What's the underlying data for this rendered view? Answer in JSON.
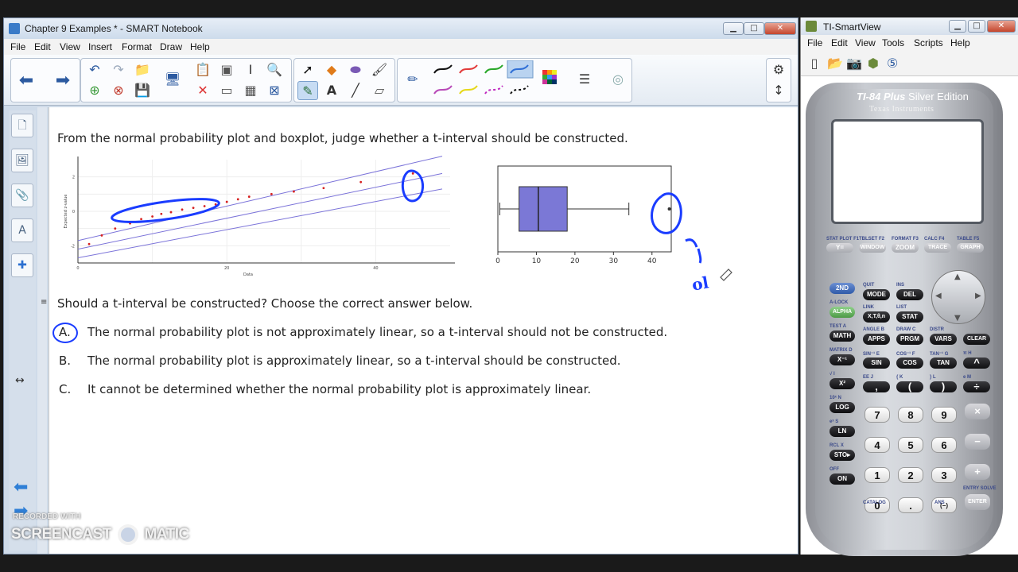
{
  "notebook": {
    "window_title": "Chapter 9 Examples * - SMART Notebook",
    "menu": [
      "File",
      "Edit",
      "View",
      "Insert",
      "Format",
      "Draw",
      "Help"
    ],
    "page": {
      "prompt": "From the normal probability plot and boxplot, judge whether a t-interval should be constructed.",
      "question": "Should a t-interval be constructed? Choose the correct answer below.",
      "options": [
        {
          "letter": "A.",
          "text": "The normal probability plot is not approximately linear, so a t-interval should not be constructed.",
          "circled": true
        },
        {
          "letter": "B.",
          "text": "The normal probability plot is approximately linear, so a t-interval should be constructed.",
          "circled": false
        },
        {
          "letter": "C.",
          "text": "It cannot be determined whether the normal probability plot is approximately linear.",
          "circled": false
        }
      ],
      "handwriting": "ol"
    },
    "pen_colors": [
      "#000000",
      "#e23b3b",
      "#2aa82a",
      "#2f6fd6",
      "#b84ab8",
      "#e6d81a",
      "#c02ac0",
      "#000000"
    ]
  },
  "chart_data": [
    {
      "type": "scatter",
      "title": "",
      "xlabel": "Data",
      "ylabel": "Expected z-value",
      "xlim": [
        0,
        50
      ],
      "ylim": [
        -3,
        3
      ],
      "xticks": [
        "0",
        "20",
        "40"
      ],
      "yticks": [
        "-2",
        "0",
        "2"
      ],
      "series": [
        {
          "values": [
            [
              1.5,
              -1.9
            ],
            [
              3.2,
              -1.4
            ],
            [
              5,
              -1.0
            ],
            [
              7,
              -0.7
            ],
            [
              8.5,
              -0.45
            ],
            [
              10,
              -0.3
            ],
            [
              11.2,
              -0.15
            ],
            [
              12.5,
              -0.05
            ],
            [
              14,
              0.1
            ],
            [
              15.5,
              0.2
            ],
            [
              17,
              0.3
            ],
            [
              18.5,
              0.4
            ],
            [
              20,
              0.55
            ],
            [
              21.5,
              0.7
            ],
            [
              23,
              0.85
            ],
            [
              26,
              1.0
            ],
            [
              29,
              1.15
            ],
            [
              33,
              1.35
            ],
            [
              38,
              1.7
            ],
            [
              45,
              2.2
            ]
          ]
        }
      ]
    },
    {
      "type": "box",
      "xlim": [
        0,
        45
      ],
      "xticks": [
        "0",
        "10",
        "20",
        "30",
        "40"
      ],
      "min": 0.5,
      "q1": 5.5,
      "median": 10.5,
      "q3": 18,
      "max": 34,
      "outliers": [
        44.5
      ]
    }
  ],
  "ti": {
    "window_title": "TI-SmartView",
    "menu": [
      "File",
      "Edit",
      "View",
      "Tools",
      "Scripts",
      "Help"
    ],
    "model": "TI-84 Plus",
    "edition": "Silver Edition",
    "brand": "Texas Instruments",
    "fkeys": [
      {
        "top": "STAT PLOT F1",
        "label": "Y="
      },
      {
        "top": "TBLSET F2",
        "label": "WINDOW"
      },
      {
        "top": "FORMAT F3",
        "label": "ZOOM"
      },
      {
        "top": "CALC F4",
        "label": "TRACE"
      },
      {
        "top": "TABLE F5",
        "label": "GRAPH"
      }
    ],
    "row_a": [
      {
        "top": "QUIT",
        "label": "MODE"
      },
      {
        "top": "INS",
        "label": "DEL"
      }
    ],
    "row_b": [
      {
        "top": "LINK",
        "label": "X,T,θ,n"
      },
      {
        "top": "LIST",
        "label": "STAT"
      }
    ],
    "row_c": [
      {
        "top": "ANGLE B",
        "label": "APPS"
      },
      {
        "top": "DRAW C",
        "label": "PRGM"
      },
      {
        "top": "DISTR",
        "label": "VARS"
      },
      {
        "top": "",
        "label": "CLEAR"
      }
    ],
    "row_d": [
      {
        "top": "SIN⁻¹ E",
        "label": "SIN"
      },
      {
        "top": "COS⁻¹ F",
        "label": "COS"
      },
      {
        "top": "TAN⁻¹ G",
        "label": "TAN"
      },
      {
        "top": "π H",
        "label": "^"
      }
    ],
    "row_e": [
      {
        "top": "EE J",
        "label": ","
      },
      {
        "top": "{ K",
        "label": "("
      },
      {
        "top": "} L",
        "label": ")"
      },
      {
        "top": "e M",
        "label": "÷"
      }
    ],
    "left_col": [
      {
        "top": "",
        "label": "2ND",
        "color": "blue"
      },
      {
        "top": "A-LOCK",
        "label": "ALPHA",
        "color": "green"
      },
      {
        "top": "TEST A",
        "label": "MATH",
        "color": "black"
      },
      {
        "top": "MATRIX D",
        "label": "X⁻¹",
        "color": "black"
      },
      {
        "top": "√ I",
        "label": "X²",
        "color": "black"
      },
      {
        "top": "10ˣ N",
        "label": "LOG",
        "color": "black"
      },
      {
        "top": "eˣ S",
        "label": "LN",
        "color": "black"
      },
      {
        "top": "RCL X",
        "label": "STO▸",
        "color": "black"
      },
      {
        "top": "OFF",
        "label": "ON",
        "color": "black"
      }
    ],
    "numpad": [
      [
        "7",
        "8",
        "9"
      ],
      [
        "4",
        "5",
        "6"
      ],
      [
        "1",
        "2",
        "3"
      ],
      [
        "0",
        ".",
        "(−)"
      ]
    ],
    "right_col": [
      "×",
      "−",
      "+",
      "ENTER"
    ],
    "catalog_label": "CATALOG",
    "ans_label": "ANS",
    "entry_label": "ENTRY SOLVE"
  },
  "watermark": {
    "line1": "RECORDED WITH",
    "line2": "SCREENCAST",
    "line3": "MATIC"
  }
}
